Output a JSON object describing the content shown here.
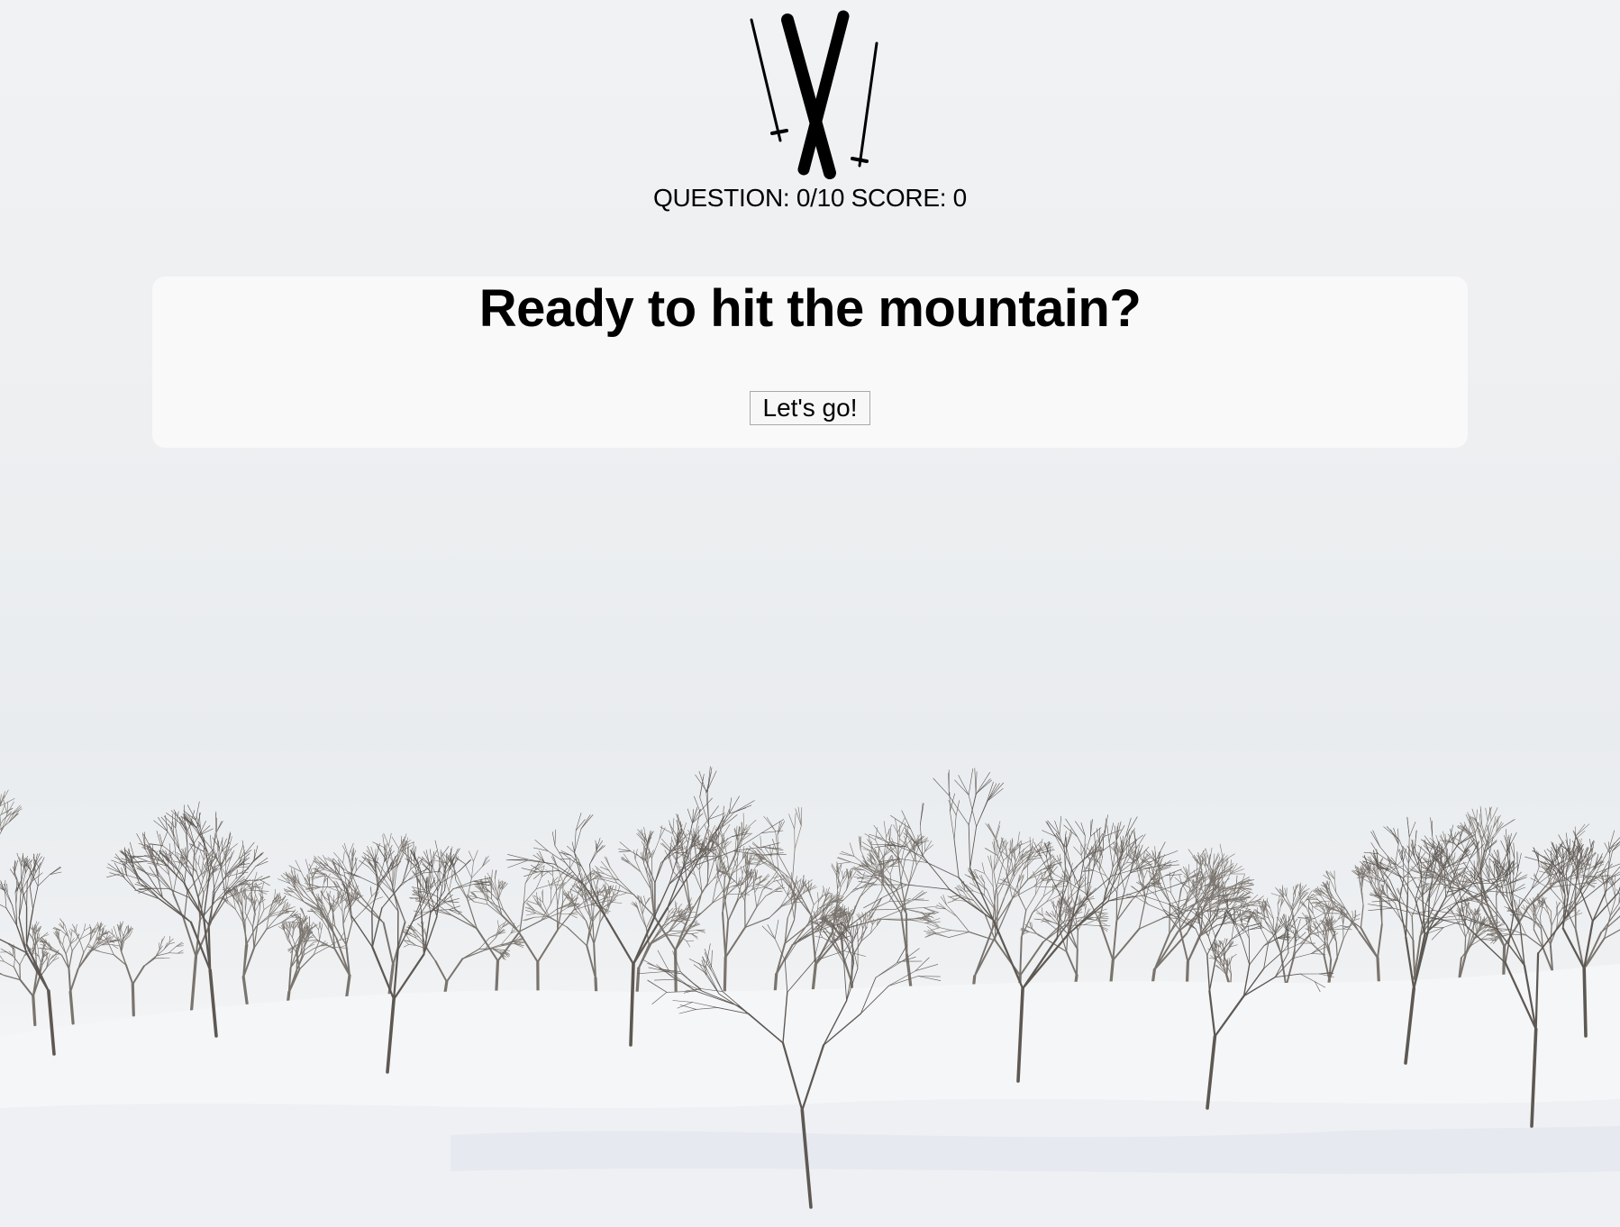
{
  "header": {
    "logo_icon": "crossed-skis-and-poles-icon",
    "question_label": "QUESTION:",
    "question_value": "0/10",
    "score_label": "SCORE:",
    "score_value": "0"
  },
  "intro": {
    "heading": "Ready to hit the mountain?",
    "start_button_label": "Let's go!"
  },
  "background": {
    "image": "snowy-birch-forest",
    "sky_color": "#eceef0",
    "snow_color": "#f6f7f9",
    "tree_color": "#6b6560"
  }
}
